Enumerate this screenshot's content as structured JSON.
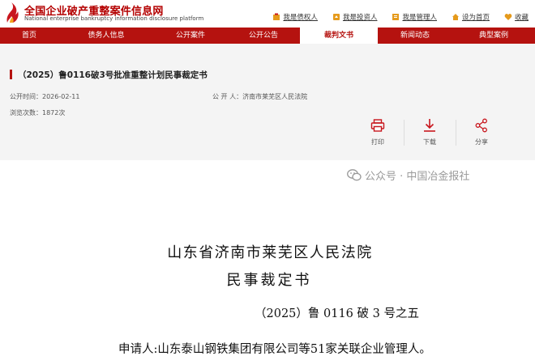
{
  "header": {
    "site_title": "全国企业破产重整案件信息网",
    "site_subtitle": "National enterprise bankruptcy  information disclosure platform",
    "links": [
      {
        "label": "我是债权人",
        "icon": "creditor-icon"
      },
      {
        "label": "我是投资人",
        "icon": "investor-icon"
      },
      {
        "label": "我是管理人",
        "icon": "administrator-icon"
      },
      {
        "label": "设为首页",
        "icon": "home-icon"
      },
      {
        "label": "收藏",
        "icon": "heart-icon"
      }
    ]
  },
  "nav": {
    "items": [
      {
        "label": "首页"
      },
      {
        "label": "债务人信息"
      },
      {
        "label": "公开案件"
      },
      {
        "label": "公开公告"
      },
      {
        "label": "裁判文书"
      },
      {
        "label": "新闻动态"
      },
      {
        "label": "典型案例"
      }
    ],
    "active": "裁判文书"
  },
  "document_info": {
    "title": "（2025）鲁0116破3号批准重整计划民事裁定书",
    "publish_time": "公开时间：2026-02-11",
    "publisher": "公 开 人：济南市莱芜区人民法院",
    "views": "浏览次数：1872次",
    "actions": [
      {
        "label": "打印",
        "icon": "printer-icon"
      },
      {
        "label": "下载",
        "icon": "download-icon"
      },
      {
        "label": "分享",
        "icon": "share-icon"
      }
    ]
  },
  "document_body": {
    "court": "山东省济南市莱芜区人民法院",
    "type": "民事裁定书",
    "case_number": "（2025）鲁 0116 破 3 号之五",
    "applicant": "申请人:山东泰山钢铁集团有限公司等51家关联企业管理人。"
  },
  "watermark": {
    "text": "公众号 · 中国冶金报社",
    "icon": "wechat-icon"
  },
  "colors": {
    "brand_red": "#b5120f",
    "panel_bg": "#f4f4f4"
  }
}
